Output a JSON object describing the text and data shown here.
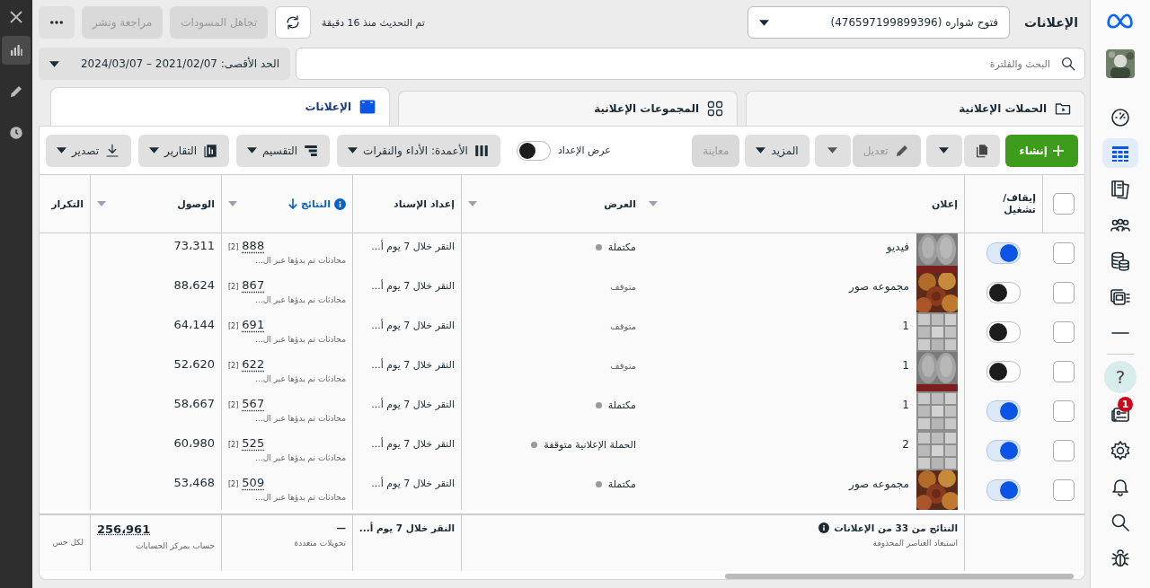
{
  "left_rail": [
    {
      "kind": "chart",
      "selected": true
    },
    {
      "kind": "pencil",
      "selected": false
    },
    {
      "kind": "clock",
      "selected": false
    }
  ],
  "nav": [
    {
      "kind": "gauge",
      "selected": false
    },
    {
      "kind": "table",
      "selected": true
    },
    {
      "kind": "pages",
      "selected": false
    },
    {
      "kind": "people",
      "selected": false
    },
    {
      "kind": "coins",
      "selected": false
    },
    {
      "kind": "ads",
      "selected": false
    },
    {
      "kind": "minus",
      "selected": false
    },
    {
      "kind": "help",
      "label": "?",
      "selected": false
    },
    {
      "kind": "news",
      "badge": "1",
      "selected": false
    },
    {
      "kind": "gear",
      "selected": false
    },
    {
      "kind": "bell",
      "selected": false
    },
    {
      "kind": "search",
      "selected": false
    },
    {
      "kind": "bug",
      "selected": false
    }
  ],
  "header": {
    "title": "الإعلانات",
    "account": "فتوح شواره (476597199899396)",
    "updated": "تم التحديث منذ 16 دقيقة",
    "buttons": [
      {
        "label": "تجاهل المسودات",
        "disabled": true
      },
      {
        "label": "مراجعة ونشر",
        "disabled": true
      }
    ]
  },
  "search": {
    "placeholder": "البحث والفلترة"
  },
  "date_range": "الحد الأقصى: 2021/02/07 – 2024/03/07",
  "tabs": [
    {
      "kind": "folder",
      "label": "الحملات الإعلانية",
      "selected": false
    },
    {
      "kind": "grid",
      "label": "المجموعات الإعلانية",
      "selected": false
    },
    {
      "kind": "ad",
      "label": "الإعلانات",
      "selected": true
    }
  ],
  "toolbar": {
    "create": "إنشاء",
    "edit": {
      "label": "تعديل",
      "disabled": true
    },
    "more": "المزيد",
    "preview": {
      "label": "معاينة",
      "disabled": true
    },
    "setup": {
      "label": "عرض الإعداد",
      "on": false
    },
    "menus": [
      {
        "kind": "columns",
        "label": "الأعمدة: الأداء والنقرات"
      },
      {
        "kind": "breakdown",
        "label": "التقسيم"
      },
      {
        "kind": "reports",
        "label": "التقارير"
      },
      {
        "kind": "export",
        "label": "تصدير"
      }
    ]
  },
  "table": {
    "select_all": {
      "checked": false
    },
    "columns": [
      {
        "label": "إيقاف/ تشغيل",
        "sorted": false,
        "menu": false
      },
      {
        "label": "إعلان",
        "sorted": false,
        "menu": true
      },
      {
        "label": "العرض",
        "sorted": false,
        "menu": true
      },
      {
        "label": "إعداد الإسناد",
        "sorted": false,
        "menu": false
      },
      {
        "label": "النتائج",
        "sorted": true,
        "menu": true
      },
      {
        "label": "الوصول",
        "sorted": false,
        "menu": true
      },
      {
        "label": "التكرار",
        "sorted": false,
        "menu": false
      }
    ],
    "rows": [
      {
        "checked": false,
        "on": true,
        "name": "فيديو",
        "delivery": "مكتملة",
        "dot": true,
        "attribution": "النقر خلال 7 يوم أ...",
        "results": "888",
        "results_note": "[2]",
        "results_sub": "محادثات تم بدؤها عبر ال...",
        "reach": "73،311"
      },
      {
        "checked": false,
        "on": false,
        "name": "مجموعه صور",
        "delivery": "متوقف",
        "dot": false,
        "attribution": "النقر خلال 7 يوم أ...",
        "results": "867",
        "results_note": "[2]",
        "results_sub": "محادثات تم بدؤها عبر ال...",
        "reach": "88،624"
      },
      {
        "checked": false,
        "on": false,
        "name": "1",
        "delivery": "متوقف",
        "dot": false,
        "attribution": "النقر خلال 7 يوم أ...",
        "results": "691",
        "results_note": "[2]",
        "results_sub": "محادثات تم بدؤها عبر ال...",
        "reach": "64،144"
      },
      {
        "checked": false,
        "on": false,
        "name": "1",
        "delivery": "متوقف",
        "dot": false,
        "attribution": "النقر خلال 7 يوم أ...",
        "results": "622",
        "results_note": "[2]",
        "results_sub": "محادثات تم بدؤها عبر ال...",
        "reach": "52،620"
      },
      {
        "checked": false,
        "on": true,
        "name": "1",
        "delivery": "مكتملة",
        "dot": true,
        "attribution": "النقر خلال 7 يوم أ...",
        "results": "567",
        "results_note": "[2]",
        "results_sub": "محادثات تم بدؤها عبر ال...",
        "reach": "58،667"
      },
      {
        "checked": false,
        "on": true,
        "name": "2",
        "delivery": "الحملة الإعلانية متوقفة",
        "dot": true,
        "attribution": "النقر خلال 7 يوم أ...",
        "results": "525",
        "results_note": "[2]",
        "results_sub": "محادثات تم بدؤها عبر ال...",
        "reach": "60،980"
      },
      {
        "checked": false,
        "on": true,
        "name": "مجموعه صور",
        "delivery": "مكتملة",
        "dot": true,
        "attribution": "النقر خلال 7 يوم أ...",
        "results": "509",
        "results_note": "[2]",
        "results_sub": "محادثات تم بدؤها عبر ال...",
        "reach": "53،468"
      }
    ],
    "footer": {
      "results_title": "النتائج من 33 من الإعلانات",
      "results_note": "استبعاد العناصر المحذوفة",
      "attribution": "النقر خلال 7 يوم أ...",
      "results": "—",
      "results_sub": "تحويلات متعددة",
      "reach": "256،961",
      "reach_sub": "حساب بمركز الحسابات",
      "frequency_sub": "لكل حس"
    }
  }
}
